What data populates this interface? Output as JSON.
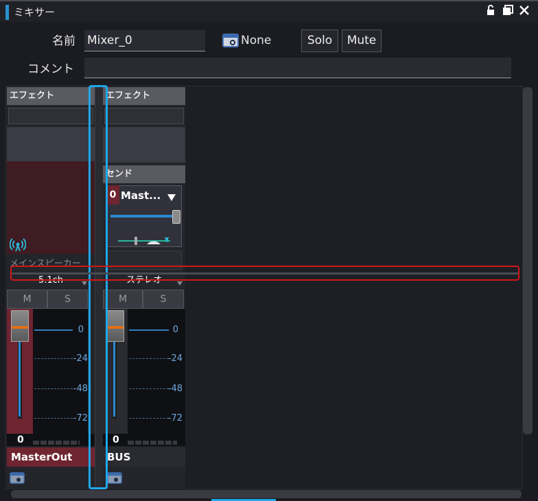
{
  "window": {
    "title": "ミキサー"
  },
  "header": {
    "name_label": "名前",
    "name_value": "Mixer_0",
    "none_label": "None",
    "solo_label": "Solo",
    "mute_label": "Mute",
    "comment_label": "コメント",
    "comment_value": ""
  },
  "strips": [
    {
      "effect_label": "エフェクト",
      "speaker_label": "メインスピーカー",
      "speaker_value": "5.1ch",
      "m_label": "M",
      "s_label": "S",
      "level_value": "0",
      "name": "MasterOut",
      "scale": [
        "0",
        "-24",
        "-48",
        "-72"
      ]
    },
    {
      "effect_label": "エフェクト",
      "send_label": "センド",
      "send_value": "0",
      "send_target": "Mast...",
      "speaker_value": "ステレオ",
      "m_label": "M",
      "s_label": "S",
      "level_value": "0",
      "name": "BUS",
      "scale": [
        "0",
        "-24",
        "-48",
        "-72"
      ]
    }
  ],
  "colors": {
    "accent_blue": "#2a90d0",
    "selection_cyan": "#1fa8e8",
    "highlight_red": "#d01818",
    "master_red": "#6e2530"
  }
}
